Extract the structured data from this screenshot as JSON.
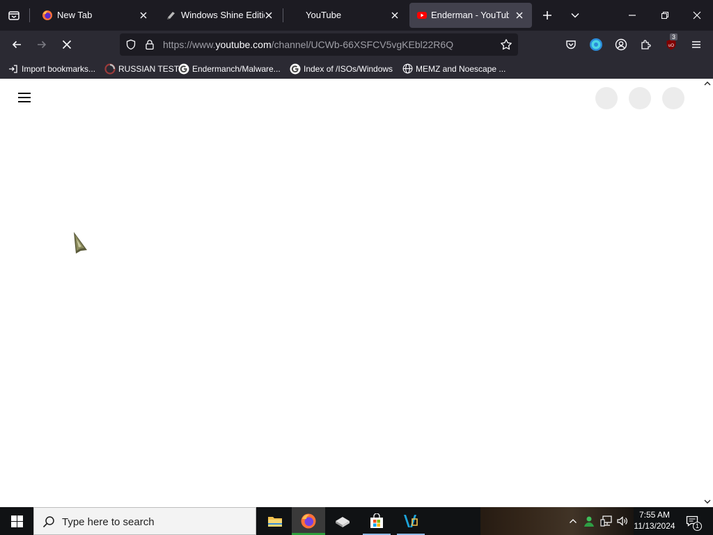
{
  "browser": {
    "tabs": [
      {
        "title": "New Tab",
        "favicon": "firefox-icon",
        "active": false
      },
      {
        "title": "Windows Shine Edition",
        "favicon": "app-icon",
        "active": false
      },
      {
        "title": "YouTube",
        "favicon": "none",
        "active": false
      },
      {
        "title": "Enderman - YouTube",
        "favicon": "youtube-icon",
        "active": true
      }
    ],
    "url": {
      "prefix": "https://www.",
      "host": "youtube.com",
      "path": "/channel/UCWb-66XSFCV5vgKEbl22R6Q"
    },
    "extension_badge": "3",
    "bookmarks": [
      {
        "label": "Import bookmarks...",
        "icon": "import-icon"
      },
      {
        "label": "RUSSIAN TEST",
        "icon": "red-circle-icon"
      },
      {
        "label": "Endermanch/Malware...",
        "icon": "google-icon"
      },
      {
        "label": "Index of /ISOs/Windows",
        "icon": "google-icon"
      },
      {
        "label": "MEMZ and Noescape ...",
        "icon": "globe-icon"
      }
    ]
  },
  "taskbar": {
    "search_placeholder": "Type here to search",
    "time": "7:55 AM",
    "date": "11/13/2024",
    "notification_count": "1"
  },
  "colors": {
    "tab_strip": "#1c1b22",
    "toolbar": "#2b2a33",
    "active_tab": "#42414d",
    "youtube_red": "#ff0000",
    "taskbar": "#101214"
  }
}
